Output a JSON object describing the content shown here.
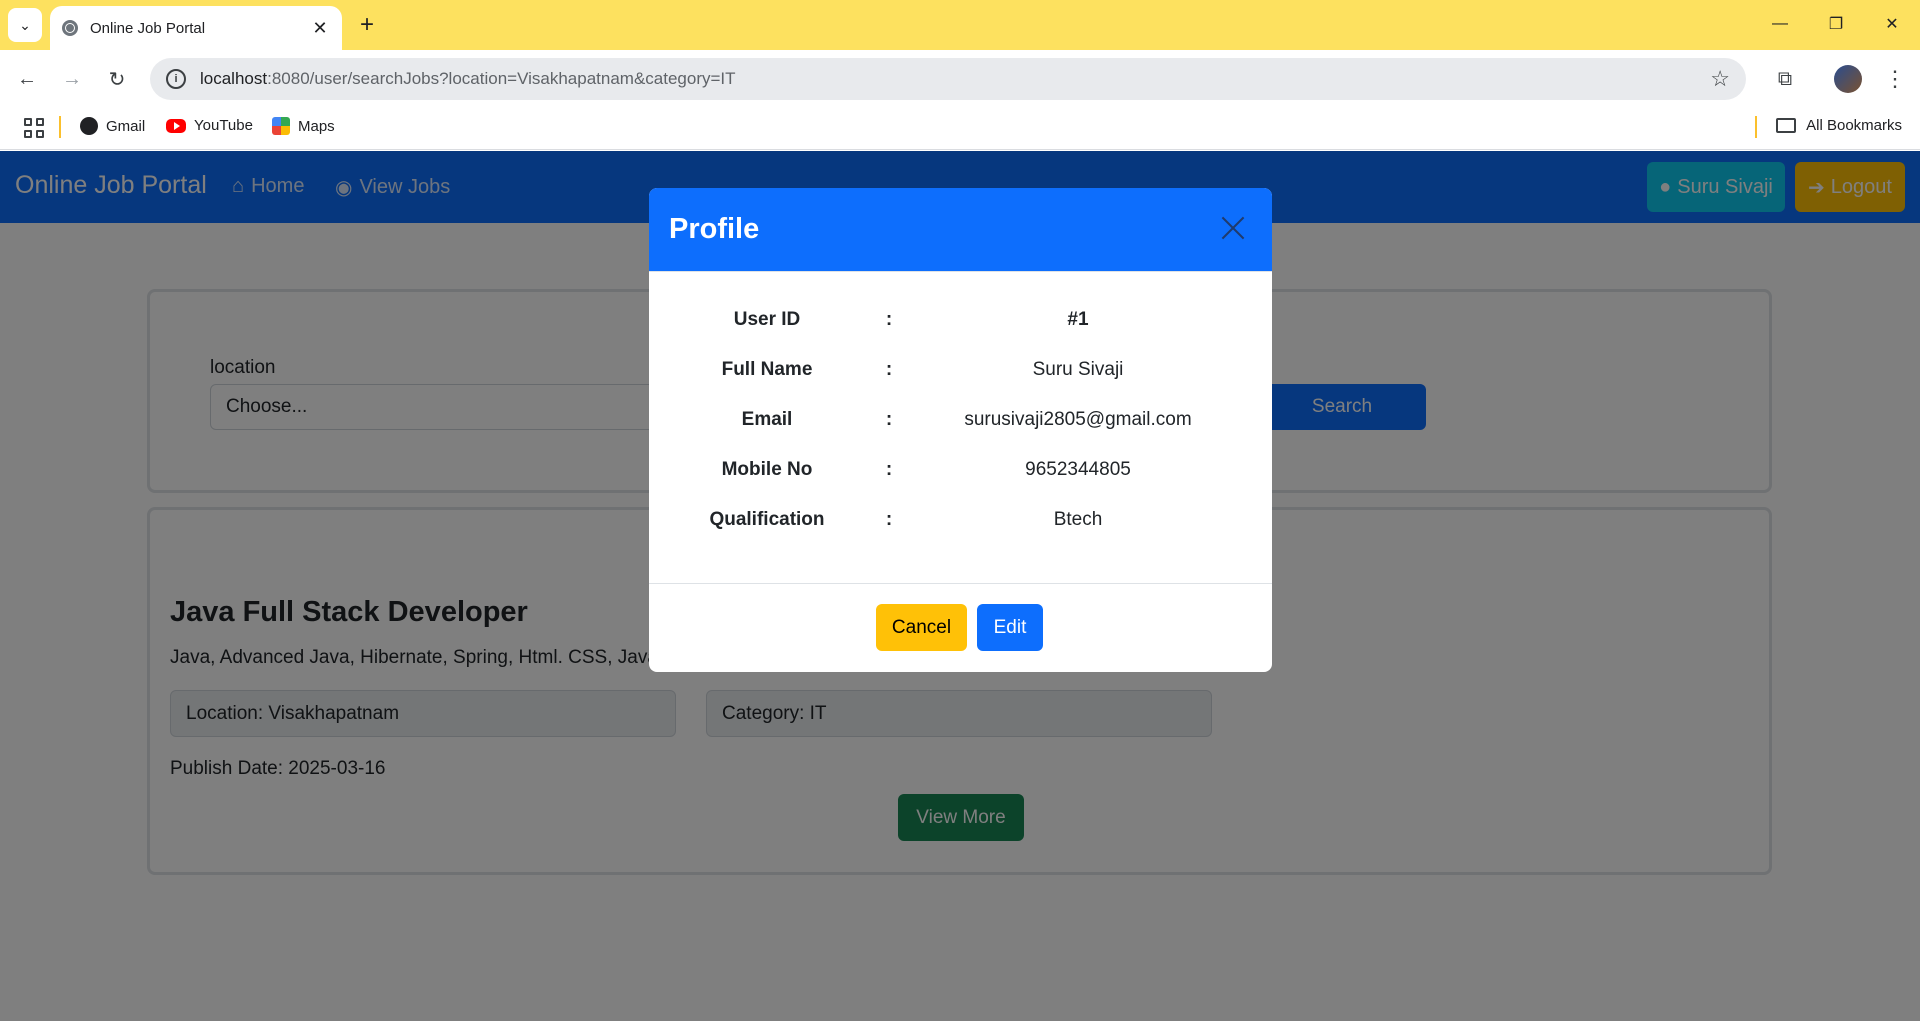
{
  "browser": {
    "tab_title": "Online Job Portal",
    "url_host": "localhost",
    "url_rest": ":8080/user/searchJobs?location=Visakhapatnam&category=IT",
    "bookmarks": [
      {
        "label": "Gmail",
        "icon": "gmail-icon"
      },
      {
        "label": "YouTube",
        "icon": "youtube-icon"
      },
      {
        "label": "Maps",
        "icon": "maps-icon"
      }
    ],
    "all_bookmarks_label": "All Bookmarks"
  },
  "navbar": {
    "brand": "Online Job Portal",
    "home_label": "Home",
    "view_jobs_label": "View Jobs",
    "user_label": "Suru Sivaji",
    "logout_label": "Logout"
  },
  "search": {
    "location_label": "location",
    "location_value": "Choose...",
    "search_button_label": "Search"
  },
  "job": {
    "title": "Java Full Stack Developer",
    "skills": "Java, Advanced Java, Hibernate, Spring, Html. CSS, JavaScript",
    "location": "Location: Visakhapatnam",
    "category": "Category: IT",
    "publish_date": "Publish Date: 2025-03-16",
    "view_more_label": "View More"
  },
  "modal": {
    "title": "Profile",
    "rows": [
      {
        "label": "User ID",
        "sep": ":",
        "value": "#1"
      },
      {
        "label": "Full Name",
        "sep": ":",
        "value": "Suru Sivaji"
      },
      {
        "label": "Email",
        "sep": ":",
        "value": "surusivaji2805@gmail.com"
      },
      {
        "label": "Mobile No",
        "sep": ":",
        "value": "9652344805"
      },
      {
        "label": "Qualification",
        "sep": ":",
        "value": "Btech"
      }
    ],
    "cancel_label": "Cancel",
    "edit_label": "Edit"
  },
  "colors": {
    "primary": "#0d6efd",
    "warning": "#ffc107",
    "info": "#0dcaf0",
    "success": "#198754",
    "browser_frame": "#fde15f"
  }
}
